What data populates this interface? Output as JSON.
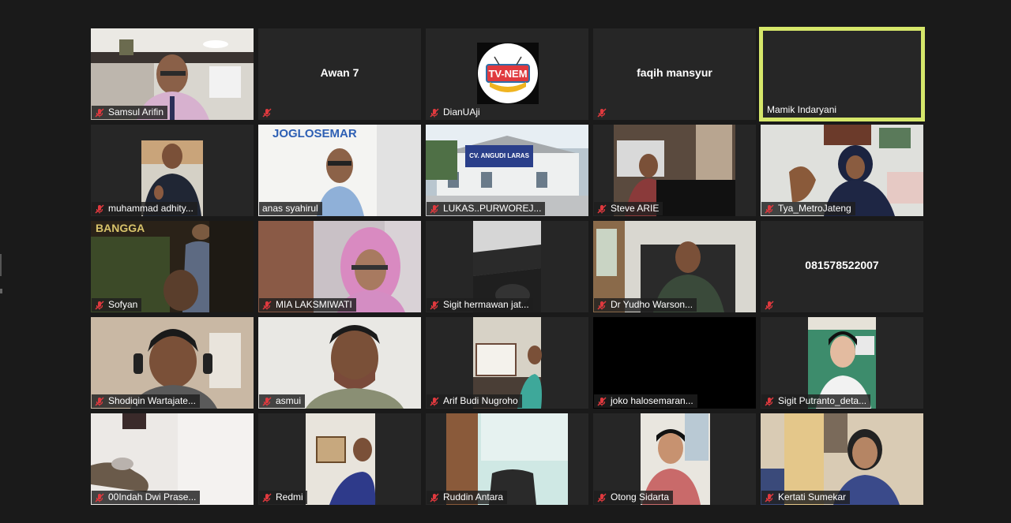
{
  "meeting": {
    "participants": [
      {
        "name": "Samsul Arifin",
        "has_video": true
      },
      {
        "name": "Awan 7",
        "has_video": false,
        "center_label": "Awan 7"
      },
      {
        "name": "DianUAji",
        "has_video": false,
        "logo_text": "TV-NEM"
      },
      {
        "name": "faqih mansyur",
        "has_video": false,
        "center_label": "faqih mansyur"
      },
      {
        "name": "Mamik Indaryani",
        "has_video": false,
        "active_speaker": true
      },
      {
        "name": "muhammad adhity...",
        "has_video": true
      },
      {
        "name": "anas syahirul",
        "has_video": true,
        "backdrop_text": "JOGLOSEMAR"
      },
      {
        "name": "LUKAS..PURWOREJ...",
        "has_video": true,
        "backdrop_text": "CV. ANGUDI LARAS"
      },
      {
        "name": "Steve ARIE",
        "has_video": true
      },
      {
        "name": "Tya_MetroJateng",
        "has_video": true
      },
      {
        "name": "Sofyan",
        "has_video": true,
        "backdrop_text": "BANGGA"
      },
      {
        "name": "MIA LAKSMIWATI",
        "has_video": true
      },
      {
        "name": "Sigit hermawan jat...",
        "has_video": true
      },
      {
        "name": "Dr  Yudho Warson...",
        "has_video": true
      },
      {
        "name": "081578522007",
        "has_video": false,
        "center_label": "081578522007"
      },
      {
        "name": "Shodiqin Wartajate...",
        "has_video": true
      },
      {
        "name": "asmui",
        "has_video": true
      },
      {
        "name": "Arif Budi Nugroho",
        "has_video": true
      },
      {
        "name": "joko halosemaran...",
        "has_video": true
      },
      {
        "name": "Sigit Putranto_deta...",
        "has_video": true
      },
      {
        "name": "00Indah Dwi Prase...",
        "has_video": true
      },
      {
        "name": "Redmi",
        "has_video": true
      },
      {
        "name": "Ruddin Antara",
        "has_video": true
      },
      {
        "name": "Otong Sidarta",
        "has_video": true
      },
      {
        "name": "Kertati Sumekar",
        "has_video": true
      }
    ]
  },
  "colors": {
    "background": "#1a1a1a",
    "tile": "#262626",
    "active_speaker_border": "#d6e76a",
    "muted_icon": "#e0393e"
  },
  "icons": {
    "muted": "microphone-muted-icon"
  }
}
